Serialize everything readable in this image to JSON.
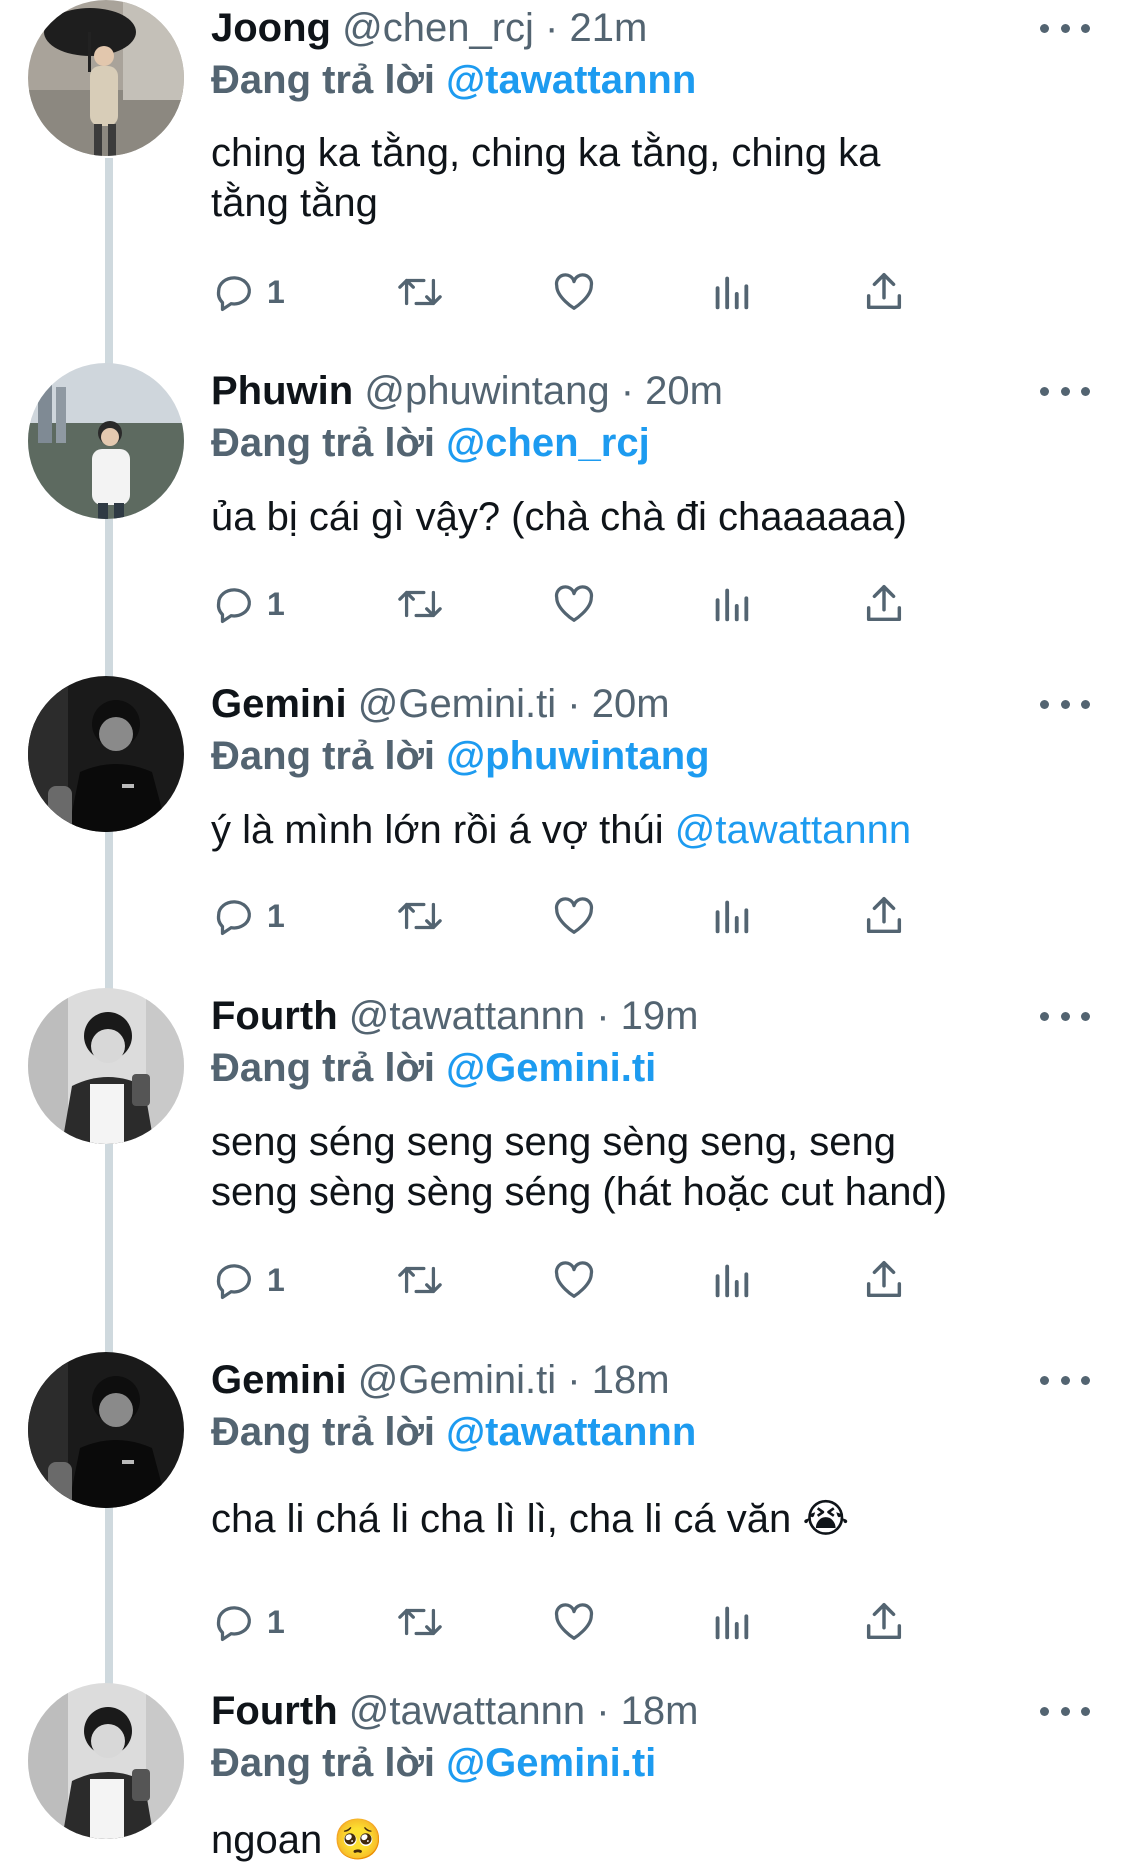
{
  "replying_label": "Đang trả lời",
  "colors": {
    "accent": "#1d9bf0",
    "secondary_text": "#536471",
    "primary_text": "#0f1419",
    "thread_line": "#cfd9de"
  },
  "icons": [
    "reply-icon",
    "retweet-icon",
    "like-icon",
    "analytics-icon",
    "share-icon",
    "more-icon"
  ],
  "tweets": [
    {
      "name": "Joong",
      "handle": "@chen_rcj",
      "time": "21m",
      "replying_to": "@tawattannn",
      "text_lines": [
        "ching ka tằng, ching ka tằng, ching ka",
        "tằng tằng"
      ],
      "reply_count": "1"
    },
    {
      "name": "Phuwin",
      "handle": "@phuwintang",
      "time": "20m",
      "replying_to": "@chen_rcj",
      "text_lines": [
        "ủa bị cái gì vậy? (chà chà đi chaaaaaa)"
      ],
      "reply_count": "1"
    },
    {
      "name": "Gemini",
      "handle": "@Gemini.ti",
      "time": "20m",
      "replying_to": "@phuwintang",
      "text_main": "ý là mình lớn rồi á vợ thúi ",
      "text_mention": "@tawattannn",
      "reply_count": "1"
    },
    {
      "name": "Fourth",
      "handle": "@tawattannn",
      "time": "19m",
      "replying_to": "@Gemini.ti",
      "text_lines": [
        "seng séng seng seng sèng seng, seng",
        "seng sèng sèng séng (hát hoặc cut hand)"
      ],
      "reply_count": "1"
    },
    {
      "name": "Gemini",
      "handle": "@Gemini.ti",
      "time": "18m",
      "replying_to": "@tawattannn",
      "text_main": "cha li chá li cha lì lì, cha li cá văn ",
      "text_emoji": "😭",
      "reply_count": "1"
    },
    {
      "name": "Fourth",
      "handle": "@tawattannn",
      "time": "18m",
      "replying_to": "@Gemini.ti",
      "text_main": "ngoan ",
      "text_emoji": "🥺"
    }
  ]
}
